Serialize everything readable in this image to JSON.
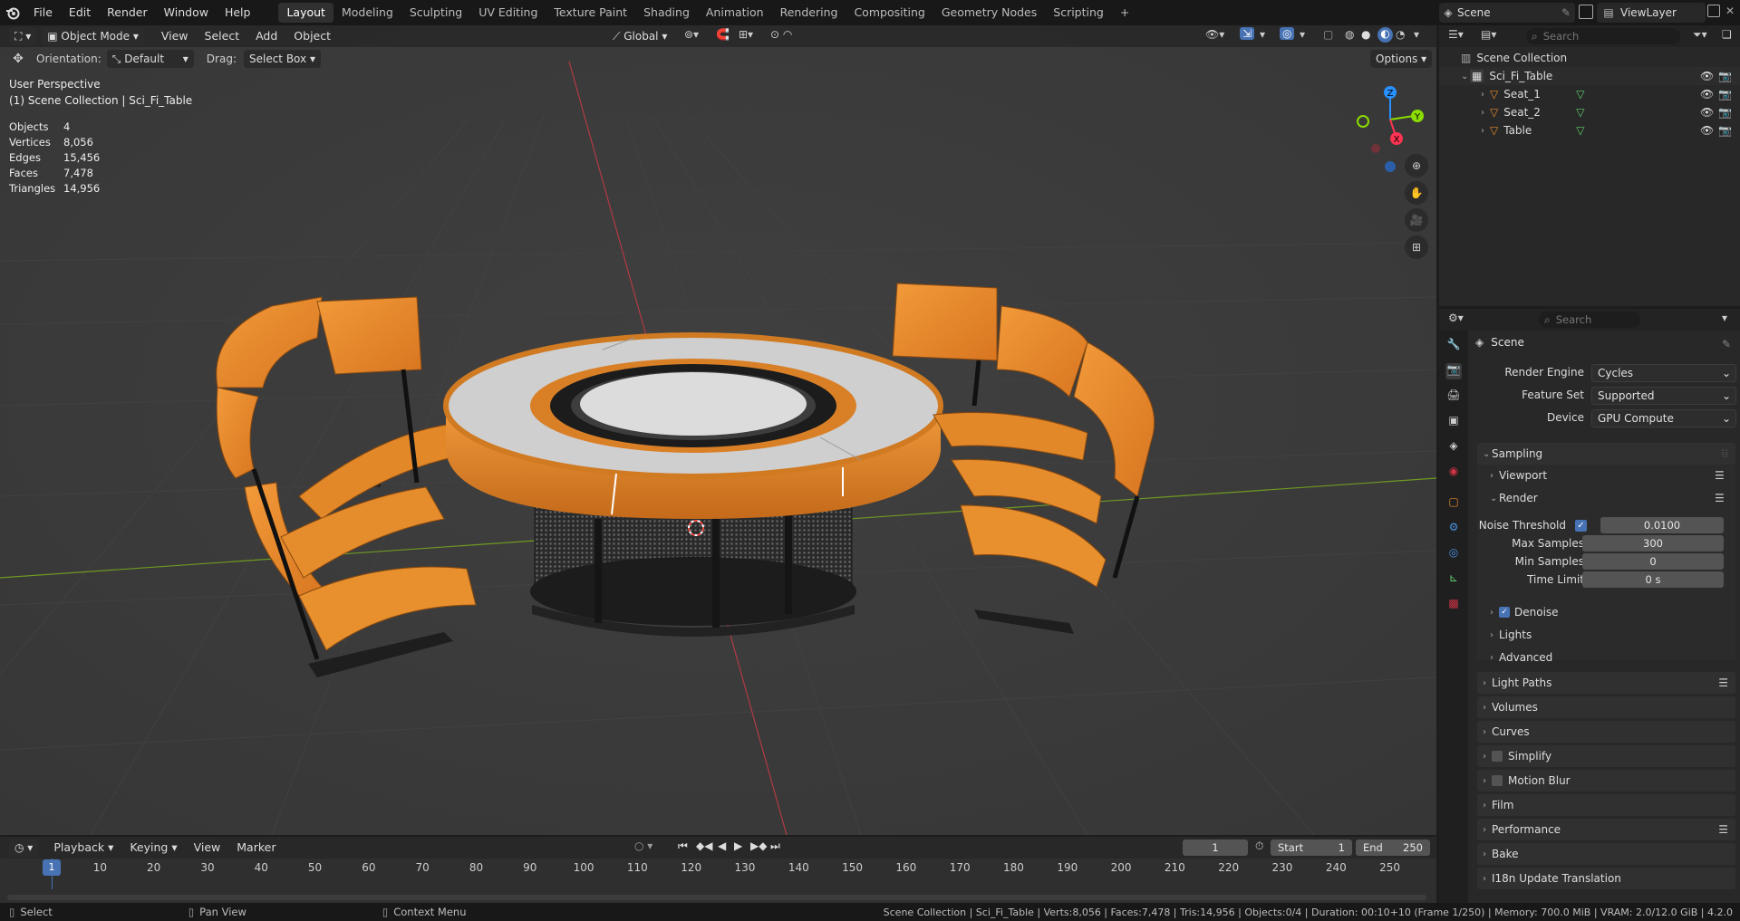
{
  "topbar": {
    "menus": [
      "File",
      "Edit",
      "Render",
      "Window",
      "Help"
    ],
    "workspaces": [
      "Layout",
      "Modeling",
      "Sculpting",
      "UV Editing",
      "Texture Paint",
      "Shading",
      "Animation",
      "Rendering",
      "Compositing",
      "Geometry Nodes",
      "Scripting"
    ],
    "add_tab": "+",
    "scene_name": "Scene",
    "view_layer": "ViewLayer"
  },
  "viewport_header": {
    "mode": "Object Mode",
    "menus": [
      "View",
      "Select",
      "Add",
      "Object"
    ],
    "transform_orientation": "Global"
  },
  "tool_header": {
    "orientation_label": "Orientation:",
    "orientation_value": "Default",
    "drag_label": "Drag:",
    "drag_value": "Select Box",
    "options": "Options"
  },
  "overlay": {
    "view_name": "User Perspective",
    "collection_info": "(1) Scene Collection | Sci_Fi_Table",
    "stats": [
      {
        "k": "Objects",
        "v": "4"
      },
      {
        "k": "Vertices",
        "v": "8,056"
      },
      {
        "k": "Edges",
        "v": "15,456"
      },
      {
        "k": "Faces",
        "v": "7,478"
      },
      {
        "k": "Triangles",
        "v": "14,956"
      }
    ]
  },
  "gizmo": {
    "x": "X",
    "y": "Y",
    "z": "Z"
  },
  "outliner": {
    "search_placeholder": "Search",
    "root": "Scene Collection",
    "collection": "Sci_Fi_Table",
    "objects": [
      "Seat_1",
      "Seat_2",
      "Table"
    ]
  },
  "properties": {
    "search_placeholder": "Search",
    "context": "Scene",
    "render_engine_label": "Render Engine",
    "render_engine": "Cycles",
    "feature_set_label": "Feature Set",
    "feature_set": "Supported",
    "device_label": "Device",
    "device": "GPU Compute",
    "sampling": "Sampling",
    "viewport": "Viewport",
    "render": "Render",
    "noise_threshold_label": "Noise Threshold",
    "noise_threshold": "0.0100",
    "max_samples_label": "Max Samples",
    "max_samples": "300",
    "min_samples_label": "Min Samples",
    "min_samples": "0",
    "time_limit_label": "Time Limit",
    "time_limit": "0 s",
    "denoise": "Denoise",
    "lights": "Lights",
    "advanced": "Advanced",
    "panels": [
      "Light Paths",
      "Volumes",
      "Curves",
      "Simplify",
      "Motion Blur",
      "Film",
      "Performance",
      "Bake",
      "I18n Update Translation"
    ]
  },
  "timeline": {
    "menus": [
      "Playback",
      "Keying",
      "View",
      "Marker"
    ],
    "current_frame": "1",
    "start_label": "Start",
    "start": "1",
    "end_label": "End",
    "end": "250",
    "ticks": [
      "1",
      "10",
      "20",
      "30",
      "40",
      "50",
      "60",
      "70",
      "80",
      "90",
      "100",
      "110",
      "120",
      "130",
      "140",
      "150",
      "160",
      "170",
      "180",
      "190",
      "200",
      "210",
      "220",
      "230",
      "240",
      "250"
    ]
  },
  "statusbar": {
    "select": "Select",
    "pan": "Pan View",
    "context": "Context Menu",
    "info": "Scene Collection | Sci_Fi_Table | Verts:8,056 | Faces:7,478 | Tris:14,956 | Objects:0/4 | Duration: 00:10+10 (Frame 1/250) | Memory: 700.0 MiB | VRAM: 2.0/12.0 GiB | 4.2.0"
  },
  "colors": {
    "accent": "#4772b3",
    "orange": "#e8892b",
    "x_axis": "#ff3352",
    "y_axis": "#8bdc00",
    "z_axis": "#2890ff"
  }
}
